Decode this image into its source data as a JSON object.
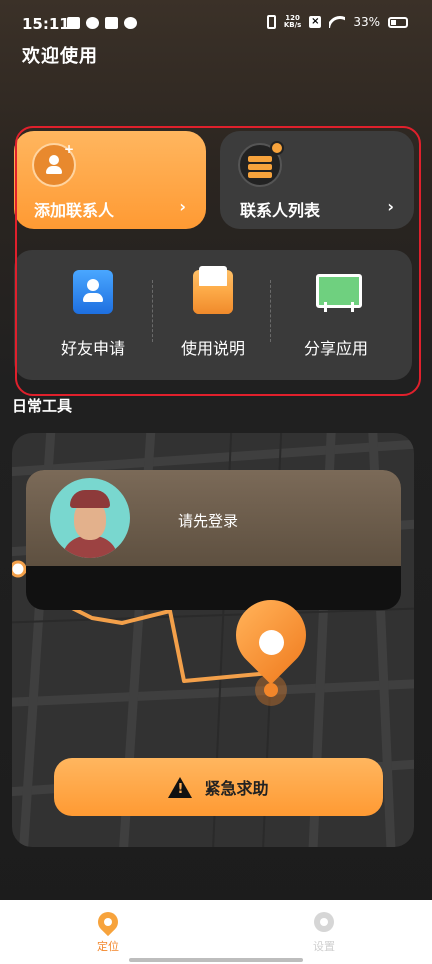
{
  "status_bar": {
    "time": "15:11",
    "net_speed_value": "120",
    "net_speed_unit": "KB/s",
    "battery": "33%"
  },
  "page": {
    "title": "欢迎使用"
  },
  "cards": {
    "add_contact": {
      "label": "添加联系人",
      "chevron": "›",
      "icon": "add-person-icon",
      "color": "#ff9a33"
    },
    "contact_list": {
      "label": "联系人列表",
      "chevron": "›",
      "icon": "contact-list-icon"
    }
  },
  "tools": [
    {
      "label": "好友申请",
      "icon": "friend-request-icon"
    },
    {
      "label": "使用说明",
      "icon": "instructions-icon"
    },
    {
      "label": "分享应用",
      "icon": "share-app-icon"
    }
  ],
  "section": {
    "daily_tools_title": "日常工具"
  },
  "login": {
    "prompt": "请先登录"
  },
  "sos": {
    "label": "紧急求助",
    "icon": "warning-icon"
  },
  "bottom_nav": {
    "locate": {
      "label": "定位",
      "active": true
    },
    "settings": {
      "label": "设置",
      "active": false
    }
  },
  "colors": {
    "accent": "#f3862a",
    "highlight_frame": "#e0202c"
  }
}
